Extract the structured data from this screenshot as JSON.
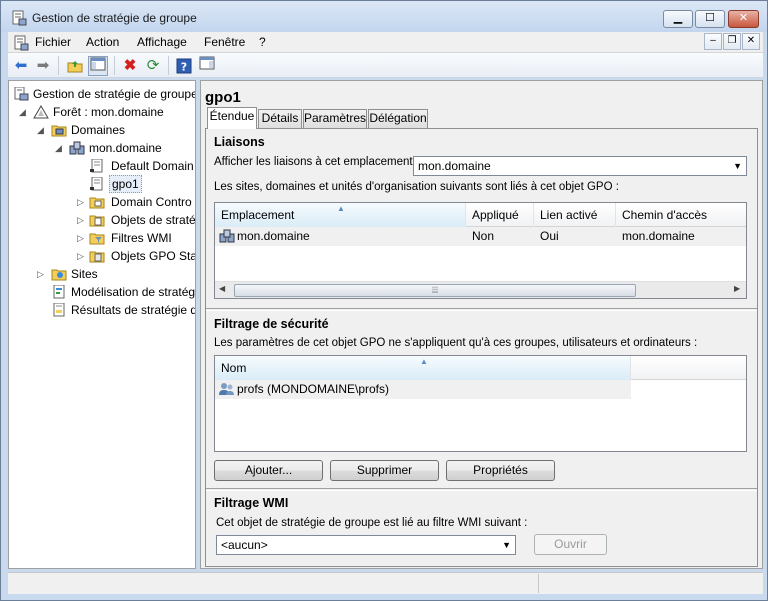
{
  "window": {
    "title": "Gestion de stratégie de groupe",
    "controls": {
      "minimize": "▁",
      "maximize": "☐",
      "close": "✕"
    }
  },
  "menu": {
    "items": [
      "Fichier",
      "Action",
      "Affichage",
      "Fenêtre",
      "?"
    ],
    "mdi_controls": {
      "minimize": "–",
      "restore": "❐",
      "close": "✕"
    }
  },
  "toolbar": {
    "buttons": [
      "back-icon",
      "forward-icon",
      "up-folder-icon",
      "show-hide-tree-icon",
      "delete-icon",
      "refresh-icon",
      "help-icon",
      "action-pane-icon"
    ]
  },
  "tree": {
    "items": [
      {
        "label": "Gestion de stratégie de groupe",
        "icon": "gpmc-icon",
        "expander": ""
      },
      {
        "label": "Forêt : mon.domaine",
        "icon": "forest-icon",
        "expander": "◢"
      },
      {
        "label": "Domaines",
        "icon": "domains-icon",
        "expander": "◢"
      },
      {
        "label": "mon.domaine",
        "icon": "domain-icon",
        "expander": "◢"
      },
      {
        "label": "Default Domain",
        "icon": "gpo-link-icon",
        "expander": ""
      },
      {
        "label": "gpo1",
        "icon": "gpo-link-icon",
        "expander": ""
      },
      {
        "label": "Domain Contro",
        "icon": "ou-icon",
        "expander": "▷"
      },
      {
        "label": "Objets de straté",
        "icon": "gpo-folder-icon",
        "expander": "▷"
      },
      {
        "label": "Filtres WMI",
        "icon": "wmi-folder-icon",
        "expander": "▷"
      },
      {
        "label": "Objets GPO Star",
        "icon": "starter-gpo-icon",
        "expander": "▷"
      },
      {
        "label": "Sites",
        "icon": "sites-icon",
        "expander": "▷"
      },
      {
        "label": "Modélisation de stratég",
        "icon": "modeling-icon",
        "expander": ""
      },
      {
        "label": "Résultats de stratégie d",
        "icon": "results-icon",
        "expander": ""
      }
    ]
  },
  "detail": {
    "title": "gpo1",
    "tabs": [
      "Étendue",
      "Détails",
      "Paramètres",
      "Délégation"
    ],
    "active_tab": "Étendue",
    "links": {
      "section_title": "Liaisons",
      "location_label": "Afficher les liaisons à cet emplacement :",
      "location_value": "mon.domaine",
      "description": "Les sites, domaines et unités d'organisation suivants sont liés à cet objet GPO :",
      "columns": [
        "Emplacement",
        "Appliqué",
        "Lien activé",
        "Chemin d'accès"
      ],
      "rows": [
        {
          "location": "mon.domaine",
          "enforced": "Non",
          "enabled": "Oui",
          "path": "mon.domaine"
        }
      ]
    },
    "security": {
      "section_title": "Filtrage de sécurité",
      "description": "Les paramètres de cet objet GPO ne s'appliquent qu'à ces groupes, utilisateurs et ordinateurs :",
      "columns": [
        "Nom"
      ],
      "rows": [
        {
          "name": "profs (MONDOMAINE\\profs)"
        }
      ],
      "buttons": {
        "add": "Ajouter...",
        "remove": "Supprimer",
        "properties": "Propriétés"
      }
    },
    "wmi": {
      "section_title": "Filtrage WMI",
      "description": "Cet objet de stratégie de groupe est lié au filtre WMI suivant :",
      "filter_value": "<aucun>",
      "open_button": "Ouvrir"
    }
  },
  "colors": {
    "title_gradient_top": "#dbe7f6",
    "selection": "#e5eef9",
    "close_red": "#c8573e"
  }
}
